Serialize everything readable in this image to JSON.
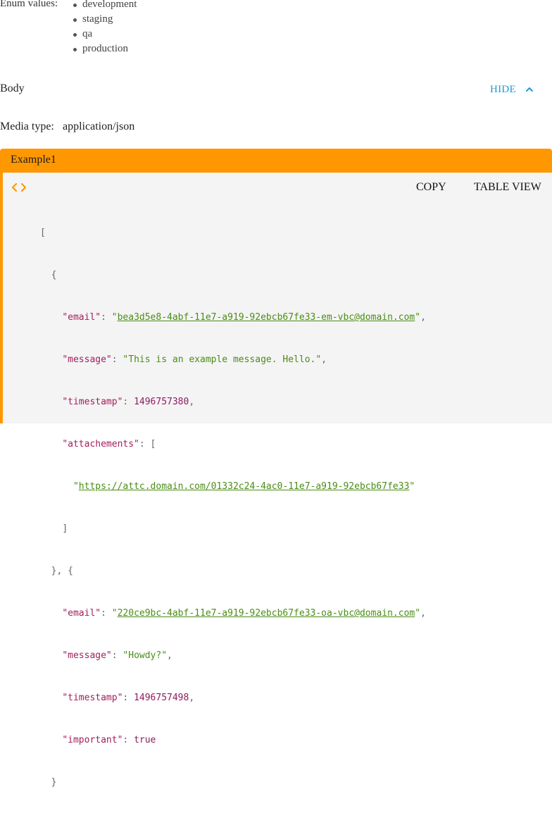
{
  "enum": {
    "label": "Enum values:",
    "values": [
      "development",
      "staging",
      "qa",
      "production"
    ]
  },
  "body_section": {
    "title": "Body",
    "toggle_label": "HIDE"
  },
  "media": {
    "label": "Media type:",
    "value": "application/json"
  },
  "example": {
    "tab_label": "Example1",
    "copy_label": "COPY",
    "table_view_label": "TABLE VIEW",
    "records": [
      {
        "email_key": "\"email\"",
        "email_value": "bea3d5e8-4abf-11e7-a919-92ebcb67fe33-em-vbc@domain.com",
        "message_key": "\"message\"",
        "message_value": "\"This is an example message. Hello.\"",
        "timestamp_key": "\"timestamp\"",
        "timestamp_value": "1496757380",
        "attachments_key": "\"attachements\"",
        "attachment_url": "https://attc.domain.com/01332c24-4ac0-11e7-a919-92ebcb67fe33"
      },
      {
        "email_key": "\"email\"",
        "email_value": "220ce9bc-4abf-11e7-a919-92ebcb67fe33-oa-vbc@domain.com",
        "message_key": "\"message\"",
        "message_value": "\"Howdy?\"",
        "timestamp_key": "\"timestamp\"",
        "timestamp_value": "1496757498",
        "important_key": "\"important\"",
        "important_value": "true"
      }
    ]
  },
  "colors": {
    "accent": "#1e9bd7",
    "example_header": "#ff9800",
    "code_key": "#a31d5d",
    "code_string": "#4a8d16"
  }
}
